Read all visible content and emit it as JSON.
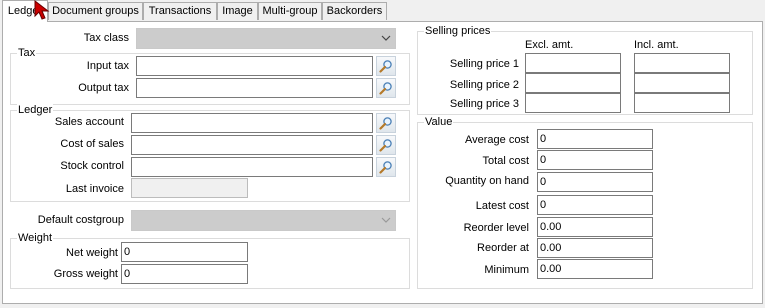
{
  "tabs": [
    "Ledger",
    "Document groups",
    "Transactions",
    "Image",
    "Multi-group",
    "Backorders"
  ],
  "left": {
    "tax_class_label": "Tax class",
    "tax_group": {
      "title": "Tax",
      "input_tax_label": "Input tax",
      "output_tax_label": "Output tax"
    },
    "ledger_group": {
      "title": "Ledger",
      "sales_account_label": "Sales account",
      "cost_of_sales_label": "Cost of sales",
      "stock_control_label": "Stock control",
      "last_invoice_label": "Last invoice"
    },
    "default_costgroup_label": "Default costgroup",
    "weight_group": {
      "title": "Weight",
      "net_weight_label": "Net weight",
      "net_weight_value": "0",
      "gross_weight_label": "Gross weight",
      "gross_weight_value": "0"
    }
  },
  "right": {
    "selling_prices": {
      "title": "Selling prices",
      "col_excl": "Excl. amt.",
      "col_incl": "Incl. amt.",
      "rows": [
        "Selling price 1",
        "Selling price 2",
        "Selling price 3"
      ]
    },
    "value": {
      "title": "Value",
      "rows": [
        {
          "label": "Average cost",
          "value": "0"
        },
        {
          "label": "Total cost",
          "value": "0"
        },
        {
          "label": "Quantity on hand",
          "value": "0"
        },
        {
          "label": "Latest cost",
          "value": "0"
        },
        {
          "label": "Reorder level",
          "value": "0.00"
        },
        {
          "label": "Reorder at",
          "value": "0.00"
        },
        {
          "label": "Minimum",
          "value": "0.00"
        }
      ]
    }
  },
  "icons": {
    "lookup": "magnifier-lookup-icon",
    "dropdown": "chevron-down-icon",
    "cursor": "mouse-pointer-icon"
  },
  "colors": {
    "panel": "#ffffff",
    "chrome": "#f0f0f0",
    "border": "#adadad",
    "disabled": "#cccccc",
    "cursor": "#cc0000"
  }
}
